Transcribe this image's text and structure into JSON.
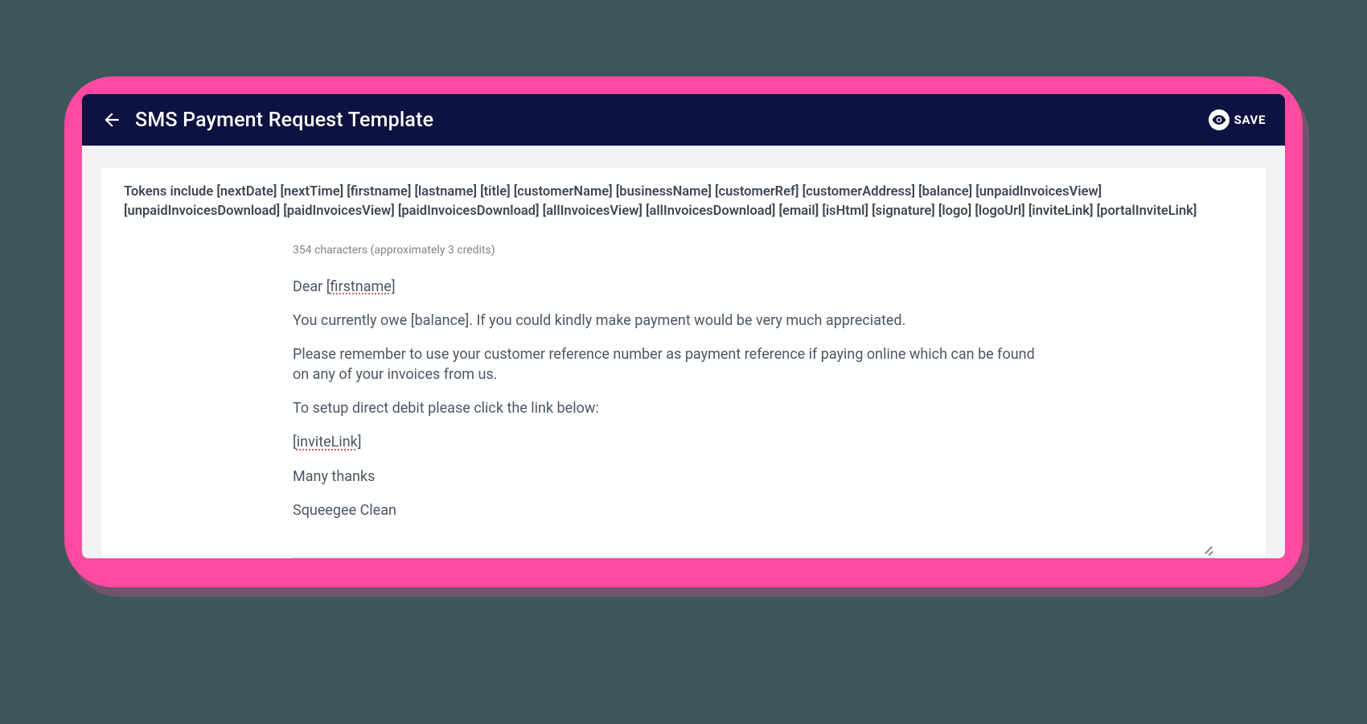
{
  "header": {
    "title": "SMS Payment Request Template",
    "save_label": "SAVE"
  },
  "tokens_help": "Tokens include [nextDate] [nextTime] [firstname] [lastname] [title] [customerName] [businessName] [customerRef] [customerAddress] [balance] [unpaidInvoicesView] [unpaidInvoicesDownload] [paidInvoicesView] [paidInvoicesDownload] [allInvoicesView] [allInvoicesDownload] [email] [isHtml] [signature] [logo] [logoUrl] [inviteLink] [portalInviteLink]",
  "editor": {
    "char_info": "354 characters (approximately 3 credits)",
    "greeting_prefix": "Dear [",
    "greeting_token": "firstname",
    "greeting_suffix": "]",
    "line_balance": "You currently owe [balance]. If you could kindly make payment would be very much appreciated.",
    "line_reference": "Please remember to use your customer reference number as payment reference if paying online which can be found on any of your invoices from us.",
    "line_dd": "To setup direct debit please click the link below:",
    "invite_open": "[",
    "invite_token": "inviteLink",
    "invite_close": "]",
    "thanks": "Many thanks",
    "signoff": "Squeegee Clean"
  }
}
